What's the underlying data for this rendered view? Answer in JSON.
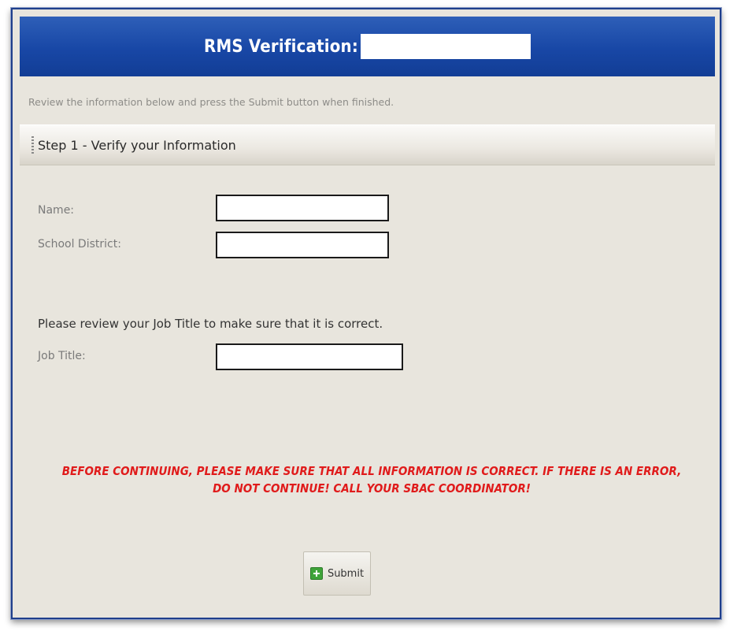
{
  "header": {
    "title": "RMS Verification:",
    "verification_value": ""
  },
  "instructions": "Review the information below and press the Submit button when finished.",
  "step": {
    "title": "Step 1 - Verify your Information"
  },
  "form": {
    "name_label": "Name:",
    "name_value": "",
    "district_label": "School District:",
    "district_value": "",
    "review_note": "Please review your Job Title to make sure that it is correct.",
    "job_title_label": "Job Title:",
    "job_title_value": ""
  },
  "warning": {
    "line1": "BEFORE CONTINUING, PLEASE MAKE SURE THAT ALL INFORMATION IS CORRECT. IF THERE IS AN ERROR,",
    "line2": "DO NOT CONTINUE! CALL YOUR SBAC COORDINATOR!"
  },
  "submit": {
    "label": "Submit",
    "icon": "add-icon"
  },
  "colors": {
    "header_blue": "#1847a6",
    "warning_red": "#e01b1b",
    "panel_bg": "#e8e5dd"
  }
}
